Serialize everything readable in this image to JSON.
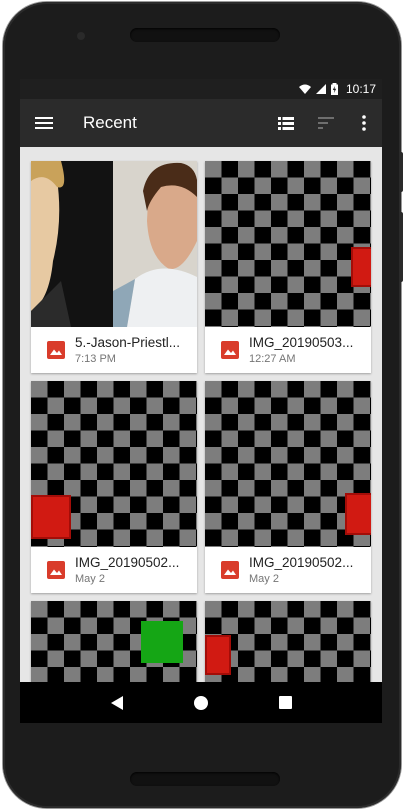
{
  "status_bar": {
    "time": "10:17"
  },
  "app_bar": {
    "title": "Recent"
  },
  "files": [
    {
      "name": "5.-Jason-Priestl...",
      "date": "7:13 PM",
      "thumb": "photo"
    },
    {
      "name": "IMG_20190503...",
      "date": "12:27 AM",
      "thumb": "checker"
    },
    {
      "name": "IMG_20190502...",
      "date": "May 2",
      "thumb": "checker"
    },
    {
      "name": "IMG_20190502...",
      "date": "May 2",
      "thumb": "checker"
    },
    {
      "name": "",
      "date": "",
      "thumb": "checker"
    },
    {
      "name": "",
      "date": "",
      "thumb": "checker"
    }
  ],
  "colors": {
    "appbar": "#2b2b2b",
    "file_icon": "#d93c2b",
    "content_bg": "#e6e6e6"
  }
}
